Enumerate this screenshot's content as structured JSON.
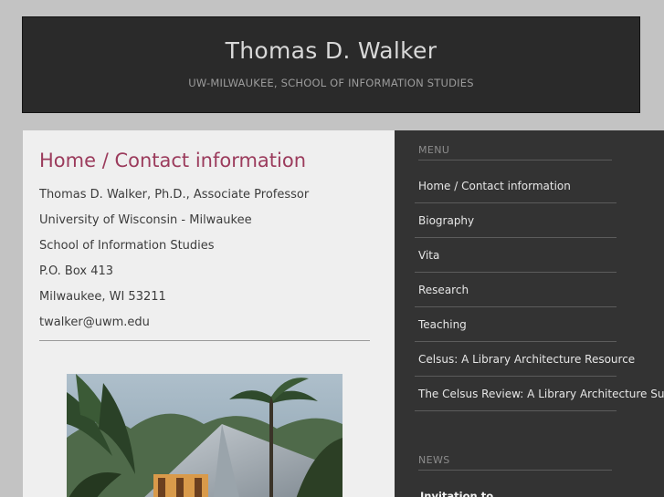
{
  "header": {
    "title": "Thomas D. Walker",
    "tagline": "UW-MILWAUKEE, SCHOOL OF INFORMATION STUDIES"
  },
  "main": {
    "heading": "Home / Contact information",
    "contact_lines": [
      "Thomas D. Walker, Ph.D., Associate Professor",
      "University of Wisconsin - Milwaukee",
      "School of Information Studies",
      "P.O. Box 413",
      "Milwaukee, WI  53211",
      "twalker@uwm.edu"
    ]
  },
  "sidebar": {
    "menu_heading": "MENU",
    "menu_items": [
      "Home / Contact information",
      "Biography",
      "Vita",
      "Research",
      "Teaching",
      "Celsus: A Library Architecture Resource",
      "The Celsus Review: A Library Architecture Su"
    ],
    "news_heading": "NEWS",
    "news_item": "Invitation to"
  }
}
